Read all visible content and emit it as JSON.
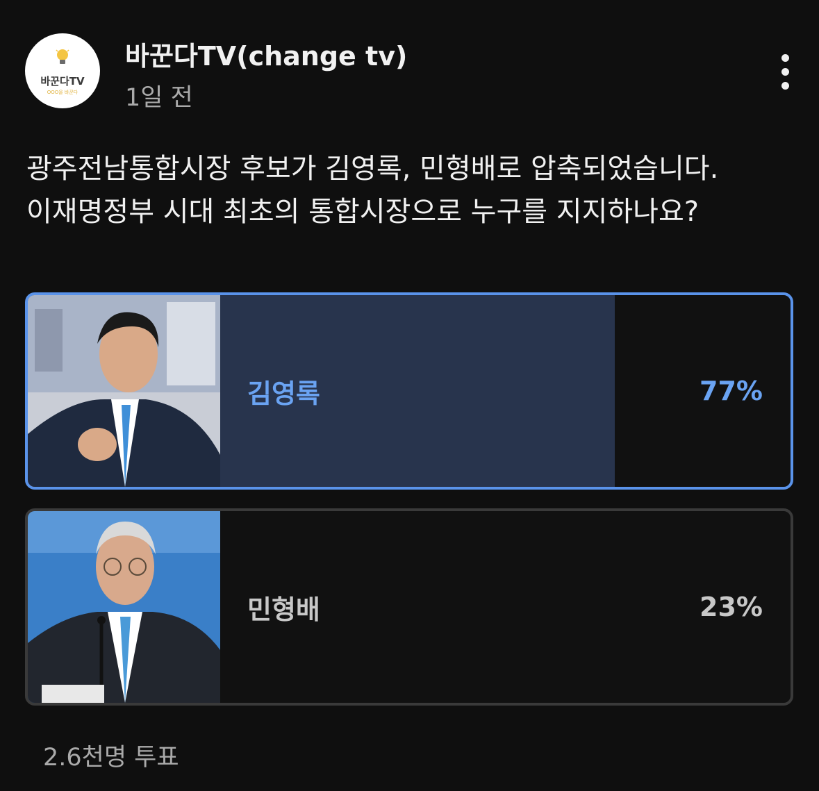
{
  "channel": {
    "name": "바꾼다TV(change tv)",
    "time": "1일 전",
    "logo_text": "바꾼다TV",
    "logo_sub": "OOO을 바꾼다"
  },
  "post": {
    "question": "광주전남통합시장 후보가 김영록, 민형배로 압축되었습니다. 이재명정부 시대 최초의 통합시장으로 누구를 지지하나요?"
  },
  "poll": {
    "options": [
      {
        "label": "김영록",
        "percent_text": "77%",
        "percent": 77,
        "selected": true
      },
      {
        "label": "민형배",
        "percent_text": "23%",
        "percent": 23,
        "selected": false
      }
    ],
    "votes": "2.6천명 투표"
  },
  "colors": {
    "background": "#0f0f0f",
    "selected_accent": "#5a93ea",
    "selected_bar": "#28344d",
    "other_bar": "#3d3d3d"
  },
  "icons": {
    "more": "more-vert-icon",
    "logo": "lightbulb-icon"
  }
}
